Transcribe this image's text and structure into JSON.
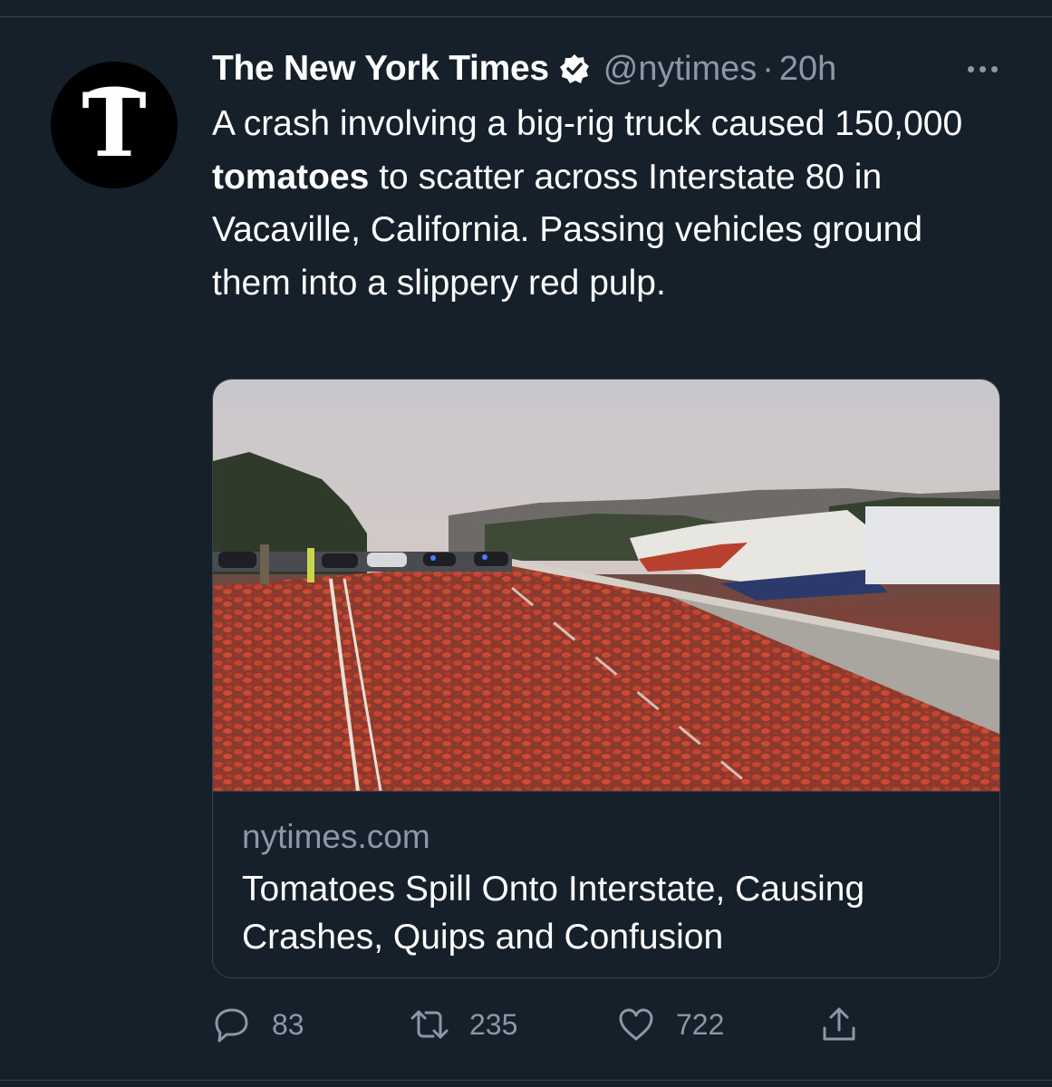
{
  "tweet": {
    "author": {
      "display_name": "The New York Times",
      "handle": "@nytimes",
      "verified": true,
      "avatar_icon": "nyt-logo-icon"
    },
    "separator": "·",
    "timestamp": "20h",
    "more_icon": "more-options-icon",
    "text": {
      "part1": "A crash involving a big-rig truck caused 150,000 ",
      "bold": "tomatoes",
      "part2": " to scatter across Interstate 80 in Vacaville, California. Passing vehicles ground them into a slippery red pulp."
    },
    "link_card": {
      "image": "Photo of a highway covered in crushed tomatoes beside an overturned truck trailer",
      "domain": "nytimes.com",
      "title": "Tomatoes Spill Onto Interstate, Causing Crashes, Quips and Confusion"
    },
    "actions": {
      "reply": {
        "icon": "reply-icon",
        "count": "83"
      },
      "retweet": {
        "icon": "retweet-icon",
        "count": "235"
      },
      "like": {
        "icon": "heart-icon",
        "count": "722"
      },
      "share": {
        "icon": "share-icon"
      }
    }
  },
  "colors": {
    "background": "#15202b",
    "border": "#38444d",
    "secondary_text": "#8b98a5",
    "primary_text": "#ffffff"
  }
}
